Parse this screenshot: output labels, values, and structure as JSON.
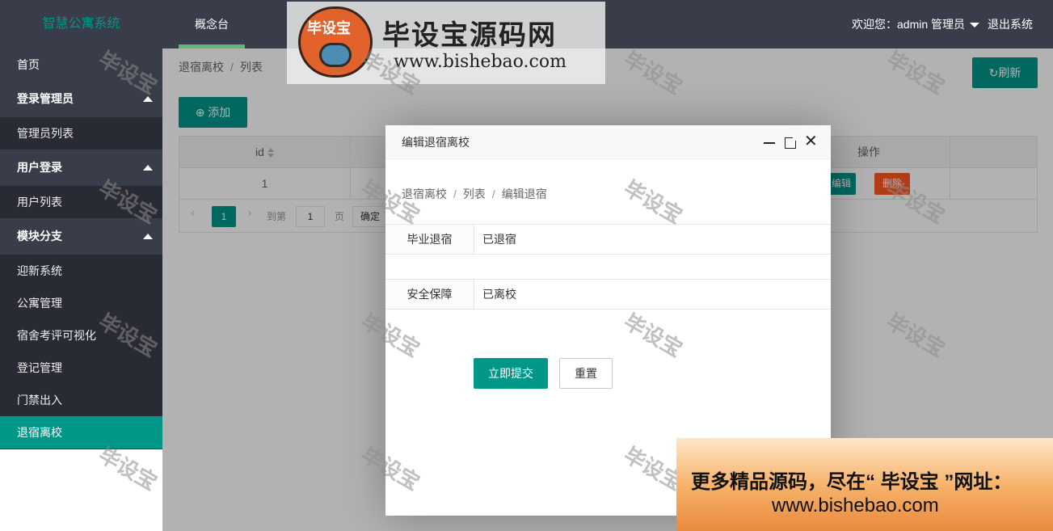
{
  "header": {
    "app_title": "智慧公寓系统",
    "nav_tab": "概念台",
    "welcome": "欢迎您：admin 管理员",
    "logout": "退出系统"
  },
  "sidebar": {
    "home": "首页",
    "groups": [
      {
        "label": "登录管理员",
        "children": [
          "管理员列表"
        ]
      },
      {
        "label": "用户登录",
        "children": [
          "用户列表"
        ]
      },
      {
        "label": "模块分支",
        "children": [
          "迎新系统",
          "公寓管理",
          "宿舍考评可视化",
          "登记管理",
          "门禁出入",
          "退宿离校"
        ]
      }
    ],
    "active": "退宿离校"
  },
  "page": {
    "breadcrumb": [
      "退宿离校",
      "列表"
    ],
    "refresh_label": "刷新",
    "add_label": "添加",
    "table": {
      "headers": [
        "id",
        "操作"
      ],
      "rows": [
        {
          "id": "1",
          "edit": "编辑",
          "delete": "删除"
        }
      ]
    },
    "pager": {
      "current": "1",
      "goto_label": "到第",
      "page_value": "1",
      "page_label": "页",
      "ok_label": "确定"
    }
  },
  "modal": {
    "title": "编辑退宿离校",
    "breadcrumb": [
      "退宿离校",
      "列表",
      "编辑退宿"
    ],
    "fields": [
      {
        "label": "毕业退宿",
        "value": "已退宿"
      },
      {
        "label": "安全保障",
        "value": "已离校"
      }
    ],
    "submit_label": "立即提交",
    "reset_label": "重置"
  },
  "watermark": {
    "logo_badge": "毕设宝",
    "logo_title": "毕设宝源码网",
    "logo_url": "www.bishebao.com",
    "text": "毕设宝",
    "promo_line1": "更多精品源码，尽在“ 毕设宝 ”网址：",
    "promo_line2": "www.bishebao.com"
  },
  "colors": {
    "accent": "#009688",
    "header_bg": "#393d49",
    "danger": "#ff5722"
  }
}
